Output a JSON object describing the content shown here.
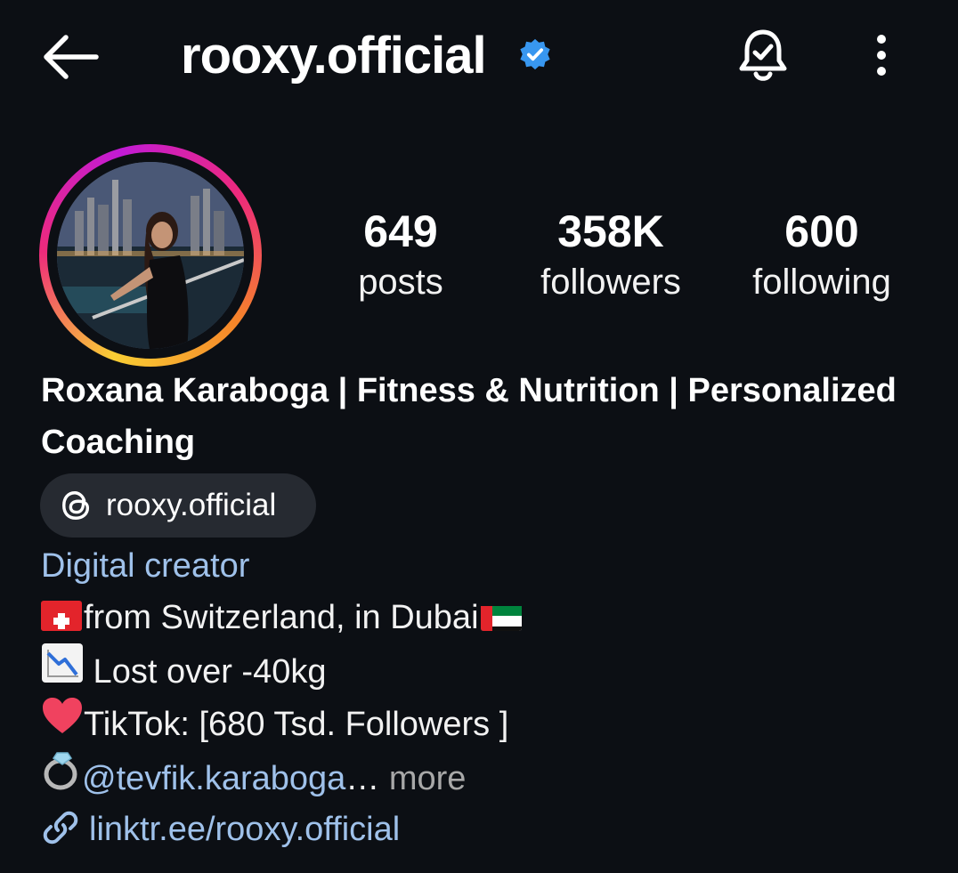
{
  "header": {
    "username": "rooxy.official",
    "verified": true,
    "icons": [
      "back-arrow-icon",
      "verified-badge-icon",
      "notification-bell-icon",
      "more-options-icon"
    ]
  },
  "stats": {
    "posts_count": "649",
    "posts_label": "posts",
    "followers_count": "358K",
    "followers_label": "followers",
    "following_count": "600",
    "following_label": "following"
  },
  "profile": {
    "full_name": "Roxana Karaboga | Fitness & Nutrition | Personalized Coaching",
    "threads_handle": "rooxy.official",
    "category": "Digital creator",
    "bio": {
      "line1": "from Switzerland, in Dubai",
      "line2": " Lost over -40kg",
      "line3": "TikTok: [680 Tsd. Followers ]",
      "line4_mention": "@tevfik.karaboga",
      "line4_ellipsis": "… ",
      "line4_more": "more"
    },
    "link": "linktr.ee/rooxy.official"
  },
  "colors": {
    "background": "#0c0f14",
    "link_blue": "#9fc1ea",
    "verified_blue": "#3897f0",
    "chip_bg": "#262a31"
  }
}
